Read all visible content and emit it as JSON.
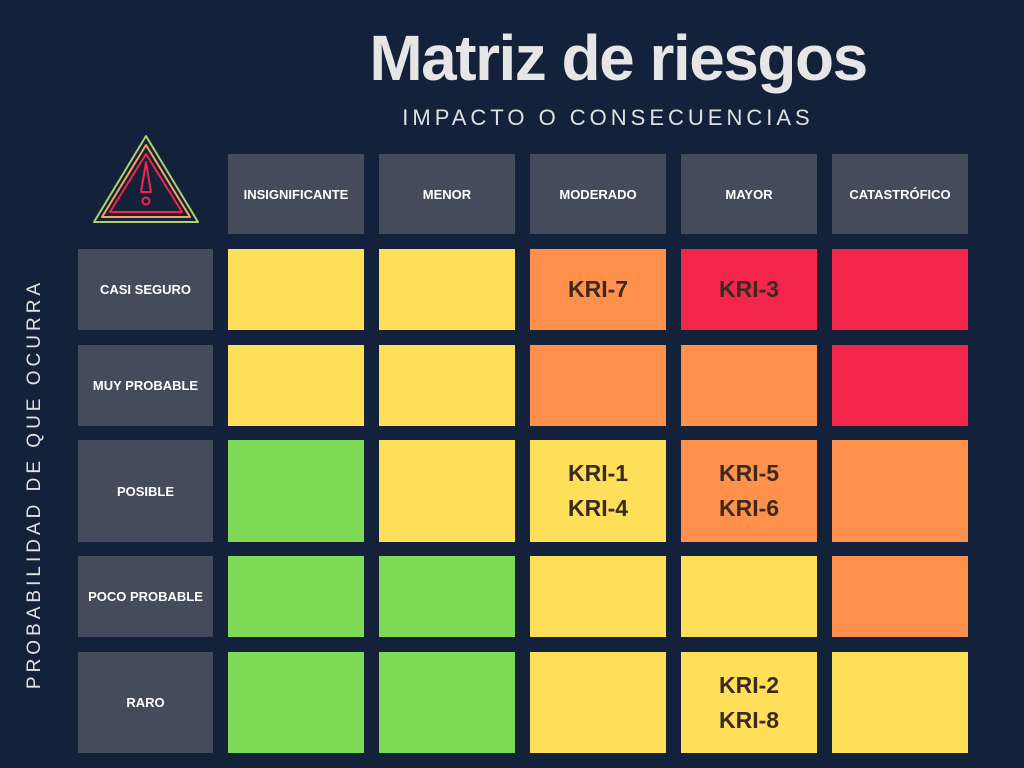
{
  "header": {
    "title": "Matriz de riesgos",
    "subtitle": "IMPACTO O  CONSECUENCIAS",
    "y_axis_label": "PROBABILIDAD DE QUE OCURRA"
  },
  "colors": {
    "background": "#14213a",
    "header_cell": "#444b5b",
    "green": "#7ed957",
    "yellow": "#ffde59",
    "orange": "#ff914d",
    "red": "#f4254b"
  },
  "columns": [
    "INSIGNIFICANTE",
    "MENOR",
    "MODERADO",
    "MAYOR",
    "CATASTRÓFICO"
  ],
  "rows": [
    {
      "label": "CASI SEGURO",
      "cells": [
        {
          "level": "yellow",
          "items": []
        },
        {
          "level": "yellow",
          "items": []
        },
        {
          "level": "orange",
          "items": [
            "KRI-7"
          ]
        },
        {
          "level": "red",
          "items": [
            "KRI-3"
          ]
        },
        {
          "level": "red",
          "items": []
        }
      ]
    },
    {
      "label": "MUY PROBABLE",
      "cells": [
        {
          "level": "yellow",
          "items": []
        },
        {
          "level": "yellow",
          "items": []
        },
        {
          "level": "orange",
          "items": []
        },
        {
          "level": "orange",
          "items": []
        },
        {
          "level": "red",
          "items": []
        }
      ]
    },
    {
      "label": "POSIBLE",
      "cells": [
        {
          "level": "green",
          "items": []
        },
        {
          "level": "yellow",
          "items": []
        },
        {
          "level": "yellow",
          "items": [
            "KRI-1",
            "KRI-4"
          ]
        },
        {
          "level": "orange",
          "items": [
            "KRI-5",
            "KRI-6"
          ]
        },
        {
          "level": "orange",
          "items": []
        }
      ]
    },
    {
      "label": "POCO PROBABLE",
      "cells": [
        {
          "level": "green",
          "items": []
        },
        {
          "level": "green",
          "items": []
        },
        {
          "level": "yellow",
          "items": []
        },
        {
          "level": "yellow",
          "items": []
        },
        {
          "level": "orange",
          "items": []
        }
      ]
    },
    {
      "label": "RARO",
      "cells": [
        {
          "level": "green",
          "items": []
        },
        {
          "level": "green",
          "items": []
        },
        {
          "level": "yellow",
          "items": []
        },
        {
          "level": "yellow",
          "items": [
            "KRI-2",
            "KRI-8"
          ]
        },
        {
          "level": "yellow",
          "items": []
        }
      ]
    }
  ]
}
